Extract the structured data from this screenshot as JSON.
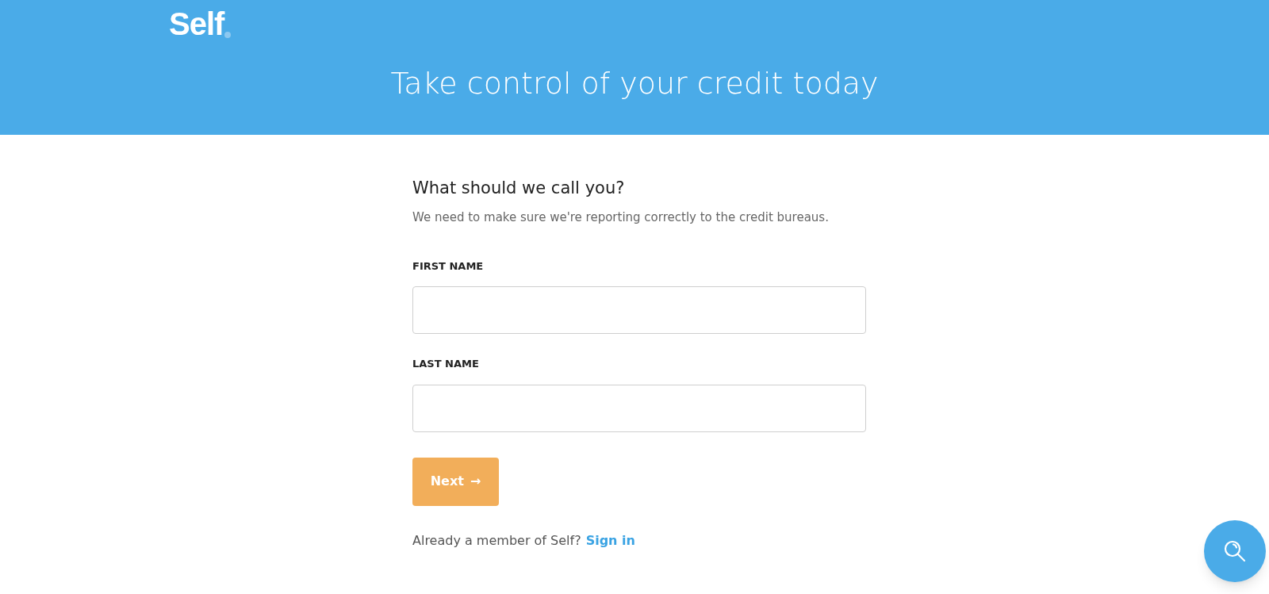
{
  "header": {
    "logo": "Self",
    "title": "Take control of your credit today"
  },
  "form": {
    "heading": "What should we call you?",
    "description": "We need to make sure we're reporting correctly to the credit bureaus.",
    "fields": [
      {
        "label": "FIRST NAME"
      },
      {
        "label": "LAST NAME"
      }
    ],
    "submit": "Next",
    "arrow": "→"
  },
  "signin": {
    "prompt": "Already a member of Self?",
    "link": "Sign in"
  }
}
